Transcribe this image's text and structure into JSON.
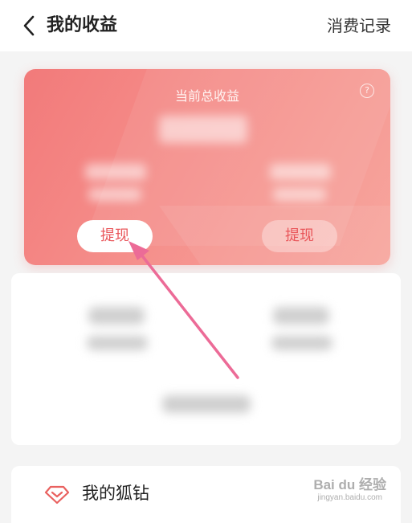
{
  "header": {
    "title": "我的收益",
    "history_label": "消费记录"
  },
  "earnings_card": {
    "title": "当前总收益",
    "help_label": "?",
    "withdraw_left_label": "提现",
    "withdraw_right_label": "提现"
  },
  "diamond_row": {
    "label": "我的狐钻"
  },
  "watermark": {
    "brand": "Bai du 经验",
    "url": "jingyan.baidu.com"
  },
  "colors": {
    "card_start": "#f27a7a",
    "card_end": "#f7a59d",
    "accent_text": "#e9565a",
    "arrow": "#ec6b97"
  },
  "icons": {
    "back": "chevron-left-icon",
    "help": "question-circle-icon",
    "diamond": "diamond-icon"
  }
}
